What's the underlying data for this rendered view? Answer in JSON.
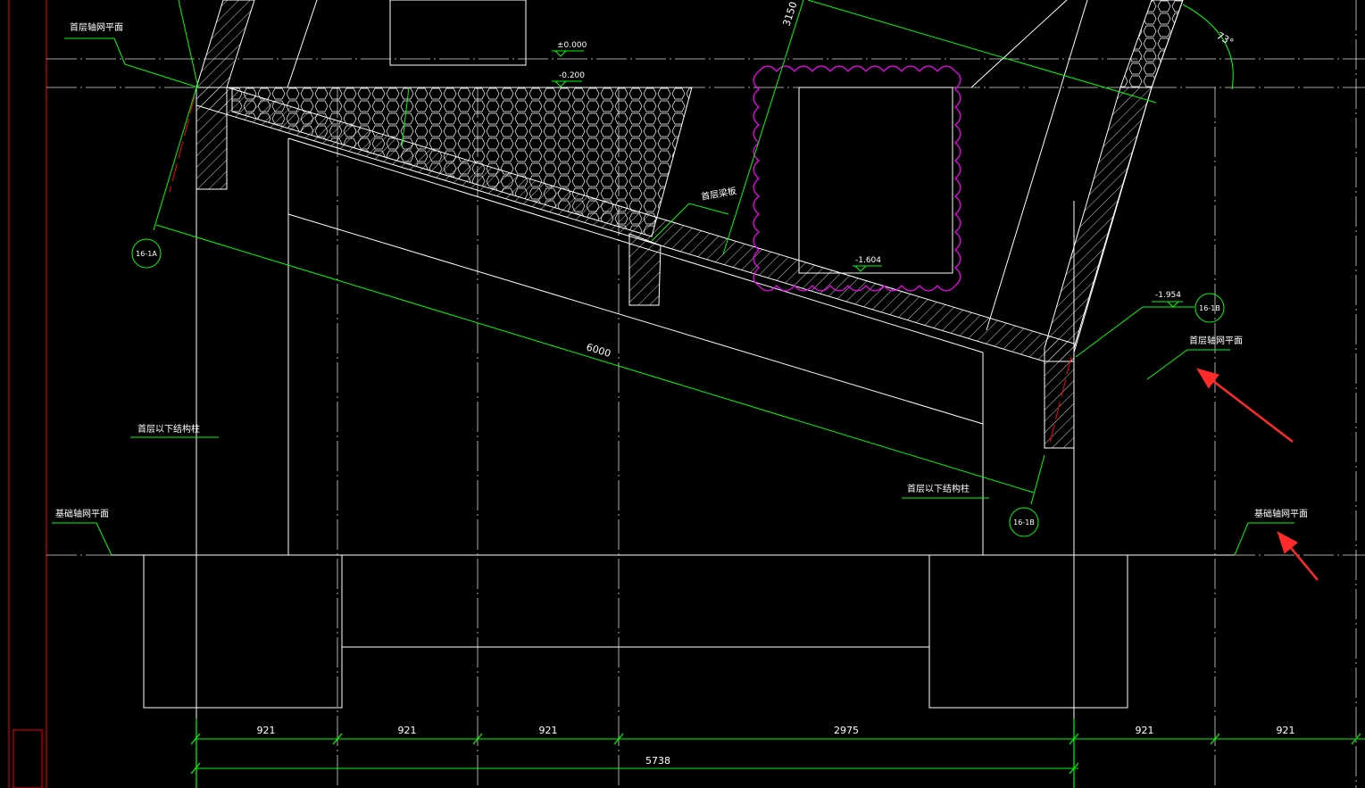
{
  "drawing": {
    "labels": {
      "first_floor_axis_left": "首层轴网平面",
      "first_floor_axis_right": "首层轴网平面",
      "base_axis_left": "基础轴网平面",
      "base_axis_right": "基础轴网平面",
      "below_first_struct_left": "首层以下结构柱",
      "below_first_struct_right": "首层以下结构柱",
      "first_floor_slab": "首层梁板"
    },
    "levels": {
      "top": "±0.000",
      "beam": "-0.200",
      "mid": "-1.604",
      "right": "-1.954"
    },
    "bubbles": {
      "left": "16-1A",
      "right_upper": "16-1B",
      "right_lower": "16-1B"
    },
    "dimensions": {
      "slope_length": "6000",
      "upper_slope": "3150",
      "angle": "73°",
      "d1": "921",
      "d2": "921",
      "d3": "921",
      "d4": "2975",
      "d5": "921",
      "d6": "921",
      "total": "5738"
    },
    "colors": {
      "background": "#000000",
      "structure": "#ffffff",
      "dimension": "#00ff00",
      "axis_grid": "#ffffff",
      "revision_cloud": "#ff00ff",
      "red_axis": "#ff0000",
      "annotation_arrow": "#ff2a2a"
    }
  }
}
